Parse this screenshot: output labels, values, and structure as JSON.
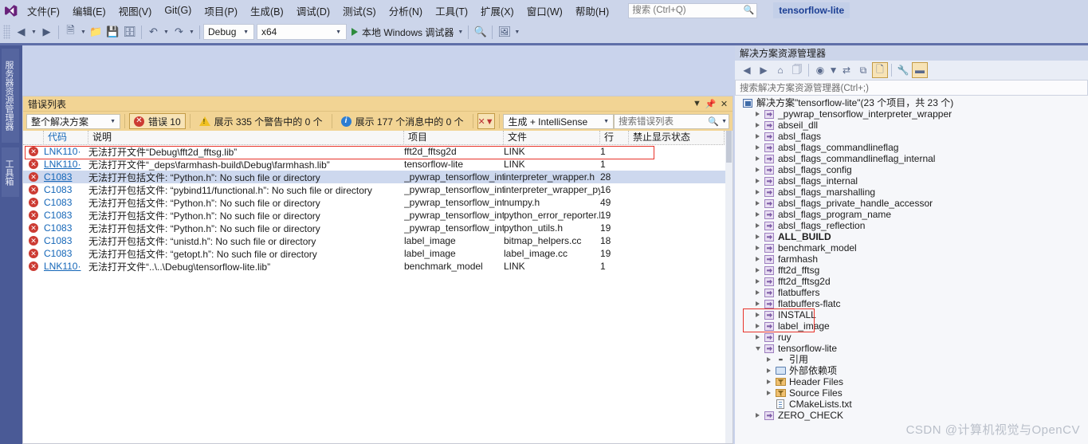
{
  "menu": {
    "logo": "vs-logo-icon",
    "items": [
      {
        "label": "文件(F)"
      },
      {
        "label": "编辑(E)"
      },
      {
        "label": "视图(V)"
      },
      {
        "label": "Git(G)"
      },
      {
        "label": "项目(P)"
      },
      {
        "label": "生成(B)"
      },
      {
        "label": "调试(D)"
      },
      {
        "label": "测试(S)"
      },
      {
        "label": "分析(N)"
      },
      {
        "label": "工具(T)"
      },
      {
        "label": "扩展(X)"
      },
      {
        "label": "窗口(W)"
      },
      {
        "label": "帮助(H)"
      }
    ],
    "search_placeholder": "搜索 (Ctrl+Q)",
    "project_badge": "tensorflow-lite"
  },
  "toolbar": {
    "config": "Debug",
    "platform": "x64",
    "run_label": "本地 Windows 调试器"
  },
  "left_strip": {
    "tabs": [
      {
        "label": "服务器资源管理器"
      },
      {
        "label": "工具箱"
      }
    ]
  },
  "error_panel": {
    "title": "错误列表",
    "scope": "整个解决方案",
    "errors_label": "错误 10",
    "warnings_label": "展示 335 个警告中的 0 个",
    "messages_label": "展示 177 个消息中的 0 个",
    "build_filter": "生成 + IntelliSense",
    "search_placeholder": "搜索错误列表",
    "columns": [
      {
        "label": "代码"
      },
      {
        "label": "说明"
      },
      {
        "label": "项目"
      },
      {
        "label": "文件"
      },
      {
        "label": "行"
      },
      {
        "label": "禁止显示状态"
      }
    ],
    "rows": [
      {
        "code": "LNK110·",
        "description": "无法打开文件“Debug\\fft2d_fftsg.lib”",
        "project": "fft2d_fftsg2d",
        "file": "LINK",
        "line": "1",
        "suppression": "",
        "selected": false,
        "highlighted": true,
        "underline": false
      },
      {
        "code": "LNK110·",
        "description": "无法打开文件“_deps\\farmhash-build\\Debug\\farmhash.lib”",
        "project": "tensorflow-lite",
        "file": "LINK",
        "line": "1",
        "suppression": "",
        "selected": false,
        "highlighted": false,
        "underline": true
      },
      {
        "code": "C1083",
        "description": "无法打开包括文件: “Python.h”: No such file or directory",
        "project": "_pywrap_tensorflow_int...",
        "file": "interpreter_wrapper.h",
        "line": "28",
        "suppression": "",
        "selected": true,
        "highlighted": false,
        "underline": true
      },
      {
        "code": "C1083",
        "description": "无法打开包括文件: “pybind11/functional.h”: No such file or directory",
        "project": "_pywrap_tensorflow_int...",
        "file": "interpreter_wrapper_py...",
        "line": "16",
        "suppression": "",
        "selected": false,
        "highlighted": false,
        "underline": false
      },
      {
        "code": "C1083",
        "description": "无法打开包括文件: “Python.h”: No such file or directory",
        "project": "_pywrap_tensorflow_int...",
        "file": "numpy.h",
        "line": "49",
        "suppression": "",
        "selected": false,
        "highlighted": false,
        "underline": false
      },
      {
        "code": "C1083",
        "description": "无法打开包括文件: “Python.h”: No such file or directory",
        "project": "_pywrap_tensorflow_int...",
        "file": "python_error_reporter.h",
        "line": "19",
        "suppression": "",
        "selected": false,
        "highlighted": false,
        "underline": false
      },
      {
        "code": "C1083",
        "description": "无法打开包括文件: “Python.h”: No such file or directory",
        "project": "_pywrap_tensorflow_int...",
        "file": "python_utils.h",
        "line": "19",
        "suppression": "",
        "selected": false,
        "highlighted": false,
        "underline": false
      },
      {
        "code": "C1083",
        "description": "无法打开包括文件: “unistd.h”: No such file or directory",
        "project": "label_image",
        "file": "bitmap_helpers.cc",
        "line": "18",
        "suppression": "",
        "selected": false,
        "highlighted": false,
        "underline": false
      },
      {
        "code": "C1083",
        "description": "无法打开包括文件: “getopt.h”: No such file or directory",
        "project": "label_image",
        "file": "label_image.cc",
        "line": "19",
        "suppression": "",
        "selected": false,
        "highlighted": false,
        "underline": false
      },
      {
        "code": "LNK110·",
        "description": "无法打开文件“..\\..\\Debug\\tensorflow-lite.lib”",
        "project": "benchmark_model",
        "file": "LINK",
        "line": "1",
        "suppression": "",
        "selected": false,
        "highlighted": false,
        "underline": true
      }
    ]
  },
  "solution_explorer": {
    "title": "解决方案资源管理器",
    "search_placeholder": "搜索解决方案资源管理器(Ctrl+;)",
    "root_label": "解决方案\"tensorflow-lite\"(23 个项目，共 23 个)",
    "nodes": [
      {
        "label": "_pywrap_tensorflow_interpreter_wrapper",
        "icon": "cpp-project-icon",
        "indent": 1,
        "expander": "collapsed",
        "bold": false,
        "highlighted": false
      },
      {
        "label": "abseil_dll",
        "icon": "cpp-project-icon",
        "indent": 1,
        "expander": "collapsed",
        "bold": false,
        "highlighted": false
      },
      {
        "label": "absl_flags",
        "icon": "cpp-project-icon",
        "indent": 1,
        "expander": "collapsed",
        "bold": false,
        "highlighted": false
      },
      {
        "label": "absl_flags_commandlineflag",
        "icon": "cpp-project-icon",
        "indent": 1,
        "expander": "collapsed",
        "bold": false,
        "highlighted": false
      },
      {
        "label": "absl_flags_commandlineflag_internal",
        "icon": "cpp-project-icon",
        "indent": 1,
        "expander": "collapsed",
        "bold": false,
        "highlighted": false
      },
      {
        "label": "absl_flags_config",
        "icon": "cpp-project-icon",
        "indent": 1,
        "expander": "collapsed",
        "bold": false,
        "highlighted": false
      },
      {
        "label": "absl_flags_internal",
        "icon": "cpp-project-icon",
        "indent": 1,
        "expander": "collapsed",
        "bold": false,
        "highlighted": false
      },
      {
        "label": "absl_flags_marshalling",
        "icon": "cpp-project-icon",
        "indent": 1,
        "expander": "collapsed",
        "bold": false,
        "highlighted": false
      },
      {
        "label": "absl_flags_private_handle_accessor",
        "icon": "cpp-project-icon",
        "indent": 1,
        "expander": "collapsed",
        "bold": false,
        "highlighted": false
      },
      {
        "label": "absl_flags_program_name",
        "icon": "cpp-project-icon",
        "indent": 1,
        "expander": "collapsed",
        "bold": false,
        "highlighted": false
      },
      {
        "label": "absl_flags_reflection",
        "icon": "cpp-project-icon",
        "indent": 1,
        "expander": "collapsed",
        "bold": false,
        "highlighted": false
      },
      {
        "label": "ALL_BUILD",
        "icon": "cpp-project-icon",
        "indent": 1,
        "expander": "collapsed",
        "bold": true,
        "highlighted": false
      },
      {
        "label": "benchmark_model",
        "icon": "cpp-project-icon",
        "indent": 1,
        "expander": "collapsed",
        "bold": false,
        "highlighted": false
      },
      {
        "label": "farmhash",
        "icon": "cpp-project-icon",
        "indent": 1,
        "expander": "collapsed",
        "bold": false,
        "highlighted": false
      },
      {
        "label": "fft2d_fftsg",
        "icon": "cpp-project-icon",
        "indent": 1,
        "expander": "collapsed",
        "bold": false,
        "highlighted": true
      },
      {
        "label": "fft2d_fftsg2d",
        "icon": "cpp-project-icon",
        "indent": 1,
        "expander": "collapsed",
        "bold": false,
        "highlighted": true
      },
      {
        "label": "flatbuffers",
        "icon": "cpp-project-icon",
        "indent": 1,
        "expander": "collapsed",
        "bold": false,
        "highlighted": false
      },
      {
        "label": "flatbuffers-flatc",
        "icon": "cpp-project-icon",
        "indent": 1,
        "expander": "collapsed",
        "bold": false,
        "highlighted": false
      },
      {
        "label": "INSTALL",
        "icon": "cpp-project-icon",
        "indent": 1,
        "expander": "collapsed",
        "bold": false,
        "highlighted": false
      },
      {
        "label": "label_image",
        "icon": "cpp-project-icon",
        "indent": 1,
        "expander": "collapsed",
        "bold": false,
        "highlighted": false
      },
      {
        "label": "ruy",
        "icon": "cpp-project-icon",
        "indent": 1,
        "expander": "collapsed",
        "bold": false,
        "highlighted": false
      },
      {
        "label": "tensorflow-lite",
        "icon": "cpp-project-icon",
        "indent": 1,
        "expander": "expanded",
        "bold": false,
        "highlighted": false
      },
      {
        "label": "引用",
        "icon": "references-icon",
        "indent": 2,
        "expander": "collapsed",
        "bold": false,
        "highlighted": false
      },
      {
        "label": "外部依赖项",
        "icon": "external-dependencies-icon",
        "indent": 2,
        "expander": "collapsed",
        "bold": false,
        "highlighted": false
      },
      {
        "label": "Header Files",
        "icon": "filter-folder-icon",
        "indent": 2,
        "expander": "collapsed",
        "bold": false,
        "highlighted": false
      },
      {
        "label": "Source Files",
        "icon": "filter-folder-icon",
        "indent": 2,
        "expander": "collapsed",
        "bold": false,
        "highlighted": false
      },
      {
        "label": "CMakeLists.txt",
        "icon": "text-file-icon",
        "indent": 2,
        "expander": "none",
        "bold": false,
        "highlighted": false
      },
      {
        "label": "ZERO_CHECK",
        "icon": "cpp-project-icon",
        "indent": 1,
        "expander": "collapsed",
        "bold": false,
        "highlighted": false
      }
    ]
  },
  "watermark": "CSDN @计算机视觉与OpenCV"
}
